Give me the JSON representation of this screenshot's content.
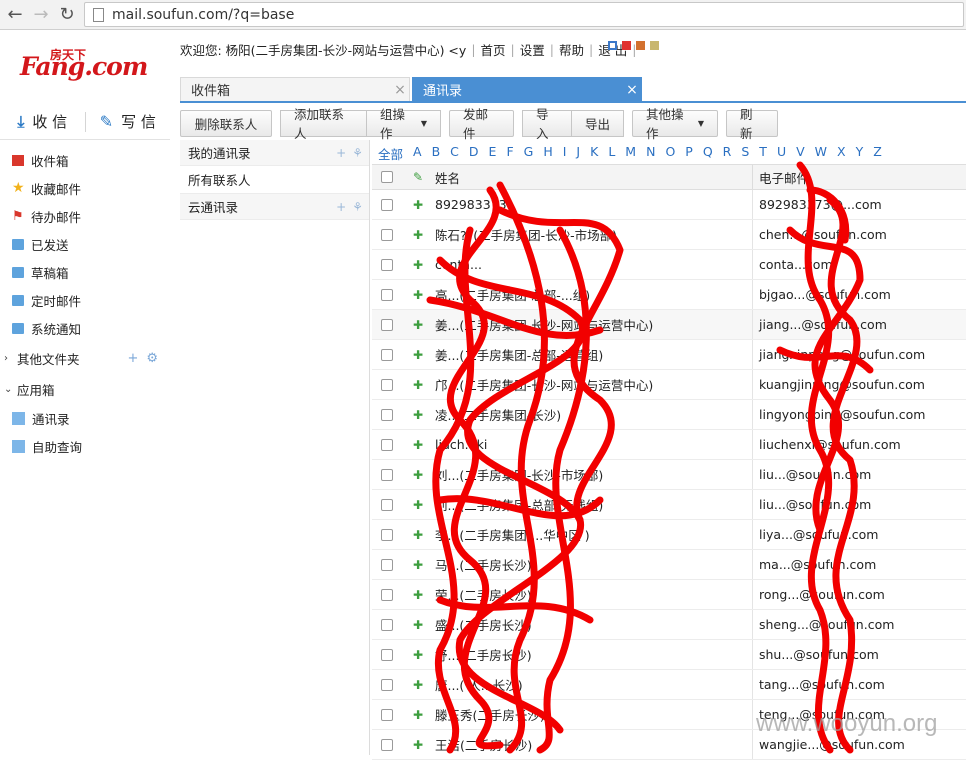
{
  "browser": {
    "url": "mail.soufun.com/?q=base"
  },
  "logo": {
    "main": "Fang.com",
    "sup": "房天下"
  },
  "header": {
    "welcome": "欢迎您: 杨阳(二手房集团-长沙-网站与运营中心) <y",
    "links": [
      "首页",
      "设置",
      "帮助",
      "退 出"
    ],
    "swatches": [
      "#3b78c9",
      "#e0322f",
      "#d3712e",
      "#c8b66e"
    ]
  },
  "tabs": [
    {
      "label": "收件箱",
      "active": false
    },
    {
      "label": "通讯录",
      "active": true
    }
  ],
  "compose": {
    "receive": "收 信",
    "write": "写 信"
  },
  "sidebar": {
    "folders": [
      {
        "label": "收件箱",
        "icon": "inbox-icon"
      },
      {
        "label": "收藏邮件",
        "icon": "star-icon"
      },
      {
        "label": "待办邮件",
        "icon": "flag-icon"
      },
      {
        "label": "已发送",
        "icon": "folder-icon"
      },
      {
        "label": "草稿箱",
        "icon": "folder-icon"
      },
      {
        "label": "定时邮件",
        "icon": "folder-icon"
      },
      {
        "label": "系统通知",
        "icon": "folder-icon"
      }
    ],
    "other_folders": "其他文件夹",
    "apps_heading": "应用箱",
    "apps": [
      "通讯录",
      "自助查询"
    ]
  },
  "toolbar": {
    "delete": "删除联系人",
    "add": "添加联系人",
    "group_ops": "组操作",
    "send_mail": "发邮件",
    "import": "导入",
    "export": "导出",
    "other_ops": "其他操作",
    "refresh": "刷新"
  },
  "groups": {
    "my_contacts": "我的通讯录",
    "all_contacts": "所有联系人",
    "cloud_contacts": "云通讯录"
  },
  "alphabet": [
    "全部",
    "A",
    "B",
    "C",
    "D",
    "E",
    "F",
    "G",
    "H",
    "I",
    "J",
    "K",
    "L",
    "M",
    "N",
    "O",
    "P",
    "Q",
    "R",
    "S",
    "T",
    "U",
    "V",
    "W",
    "X",
    "Y",
    "Z"
  ],
  "table": {
    "col_name": "姓名",
    "col_email": "电子邮件",
    "rows": [
      {
        "name": "892983373",
        "email": "892983373@...com"
      },
      {
        "name": "陈石??(二手房集团-长沙-市场部)",
        "email": "chen...@soufun.com"
      },
      {
        "name": "conta...",
        "email": "conta...com"
      },
      {
        "name": "高...(二手房集团-总部-...组)",
        "email": "bjgao...@soufun.com"
      },
      {
        "name": "姜...(二手房集团-长沙-网站与运营中心)",
        "email": "jiang...@soufun.com"
      },
      {
        "name": "姜...(二手房集团-总部-运营组)",
        "email": "jiangxinpeng@soufun.com"
      },
      {
        "name": "邝...(二手房集团-长沙-网站与运营中心)",
        "email": "kuangjinping@soufun.com"
      },
      {
        "name": "凌...(二手房集团-长沙)",
        "email": "lingyongping@soufun.com"
      },
      {
        "name": "liuch...ki",
        "email": "liuchenxi@soufun.com"
      },
      {
        "name": "刘...(二手房集团-长沙-市场部)",
        "email": "liu...@soufun.com"
      },
      {
        "name": "刘...(二手房集团-总部-无线组)",
        "email": "liu...@soufun.com"
      },
      {
        "name": "李...(二手房集团-...华中区 )",
        "email": "liya...@soufun.com"
      },
      {
        "name": "马...(二手房长沙)",
        "email": "ma...@soufun.com"
      },
      {
        "name": "荣...(二手房长沙)",
        "email": "rong...@soufun.com"
      },
      {
        "name": "盛...(二手房长沙)",
        "email": "sheng...@soufun.com"
      },
      {
        "name": "舒...(二手房长沙)",
        "email": "shu...@soufun.com"
      },
      {
        "name": "唐...( 人...长沙)",
        "email": "tang...@soufun.com"
      },
      {
        "name": "滕玉秀(二手房长沙)",
        "email": "teng...@soufun.com"
      },
      {
        "name": "王洁(二手房长沙)",
        "email": "wangjie...@soufun.com"
      }
    ]
  },
  "watermark": "www.wooyun.org"
}
